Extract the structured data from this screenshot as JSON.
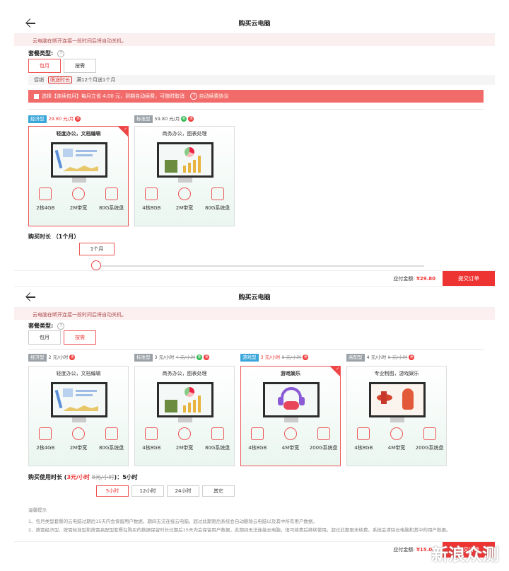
{
  "s1": {
    "title": "购买云电脑",
    "notice": "云电脑在断开连接一段时间后将自动关机。",
    "plan_label": "套餐类型:",
    "help": "?",
    "toggle_monthly": "包月",
    "toggle_hourly": "按需",
    "promo_prefix": "促销",
    "promo_tag": "限送时长",
    "promo_text": "满12个月送1个月",
    "redbar_text": "选择【连续包月】每月立省 4.00 元，到期自动续费，可随时取消",
    "redbar_link": "自动续费协议",
    "cards": [
      {
        "badge": "经济型",
        "price": "29.80 元/月",
        "title": "轻度办公，文档编辑",
        "specs": [
          "2核4GB",
          "2M带宽",
          "80G系统盘"
        ]
      },
      {
        "badge": "标准型",
        "price": "59.80 元/月",
        "title": "商务办公，图表处理",
        "specs": [
          "4核8GB",
          "2M带宽",
          "80G系统盘"
        ]
      }
    ],
    "duration_label": "购买时长 （1个月）",
    "duration_value": "1个月",
    "due_label": "应付金额: ",
    "due_amount": "¥29.80",
    "submit": "提交订单"
  },
  "s2": {
    "title": "购买云电脑",
    "notice": "云电脑在断开连接一段时间后将自动关机。",
    "plan_label": "套餐类型:",
    "help": "?",
    "toggle_monthly": "包月",
    "toggle_hourly": "按需",
    "cards": [
      {
        "badge": "经济型",
        "price": "2 元/小时",
        "title": "轻度办公，文档编辑",
        "specs": [
          "2核4GB",
          "2M带宽",
          "80G系统盘"
        ]
      },
      {
        "badge": "标准型",
        "price": "3 元/小时",
        "old_price": "4 元/小时",
        "title": "商务办公，图表处理",
        "specs": [
          "4核8GB",
          "2M带宽",
          "80G系统盘"
        ]
      },
      {
        "badge": "游戏型",
        "price": "3 元/小时",
        "old_price": "8 元/小时",
        "title": "游戏娱乐",
        "specs": [
          "4核8GB",
          "4M带宽",
          "200G系统盘"
        ]
      },
      {
        "badge": "高配型",
        "price": "4 元/小时",
        "old_price": "8 元/小时",
        "title": "专业制图，游戏娱乐",
        "specs": [
          "4核8GB",
          "4M带宽",
          "200G系统盘"
        ]
      }
    ],
    "usage_label": "购买使用时长",
    "usage_price": "3元/小时",
    "usage_old": "8元/小时",
    "usage_sep": "：",
    "usage_hours": "5小时",
    "options": [
      "5小时",
      "12小时",
      "24小时",
      "其它"
    ],
    "tips_title": "温馨提示",
    "tips": [
      "1、包月类型套餐的云电脑过期后15天内会保留用户数据，期间无法连接云电脑，超过此期限后系统会自动删除云电脑以及其中所有用户数据。",
      "2、按需经济型、按需标准型和按需高配型套餐在购买的数据保留时长过期后15天内会保留用户数据，此期间无法连接云电脑，但可续费后继续使用。超过此期限未续费，系统会清除云电脑和其中的用户数据。"
    ],
    "due_label": "应付金额: ",
    "due_amount": "¥15.00",
    "submit": "提交订单",
    "watermark": "新浪众测"
  }
}
